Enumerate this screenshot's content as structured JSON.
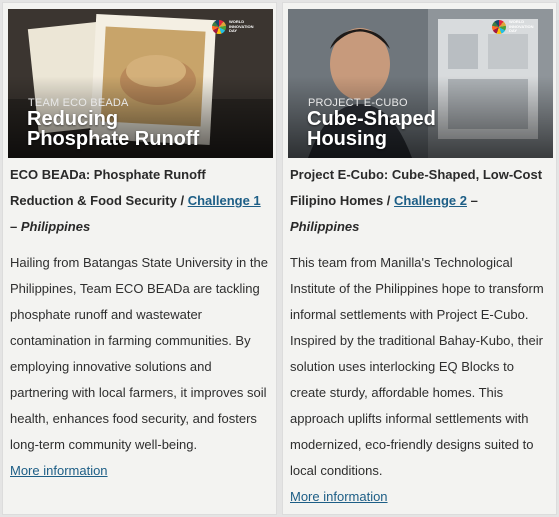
{
  "cards": [
    {
      "thumb_tag": "TEAM ECO BEADA",
      "thumb_title_line1": "Reducing",
      "thumb_title_line2": "Phosphate Runoff",
      "badge_text": "WORLD INNOVATION DAY",
      "title": "ECO BEADa: Phosphate Runoff Reduction & Food Security / ",
      "challenge_link": "Challenge 1",
      "dash": " – ",
      "country": "Philippines",
      "description": "Hailing from Batangas State University in the Philippines, Team ECO BEADa are tackling phosphate runoff and wastewater contamination in farming communities. By employing innovative solutions and partnering with local farmers, it improves soil health, enhances food security, and fosters long-term community well-being.",
      "more_link": "More information"
    },
    {
      "thumb_tag": "PROJECT E-CUBO",
      "thumb_title_line1": "Cube-Shaped",
      "thumb_title_line2": "Housing",
      "badge_text": "WORLD INNOVATION DAY",
      "title": "Project E-Cubo: Cube-Shaped, Low-Cost Filipino Homes / ",
      "challenge_link": "Challenge 2",
      "dash": " – ",
      "country": "Philippines",
      "description": "This team from Manilla's Technological Institute of the Philippines hope to transform informal settlements with Project E-Cubo. Inspired by the traditional Bahay-Kubo, their solution uses interlocking EQ Blocks to create sturdy, affordable homes. This approach uplifts informal settlements with modernized, eco-friendly designs suited to local conditions.",
      "more_link": "More information"
    }
  ]
}
